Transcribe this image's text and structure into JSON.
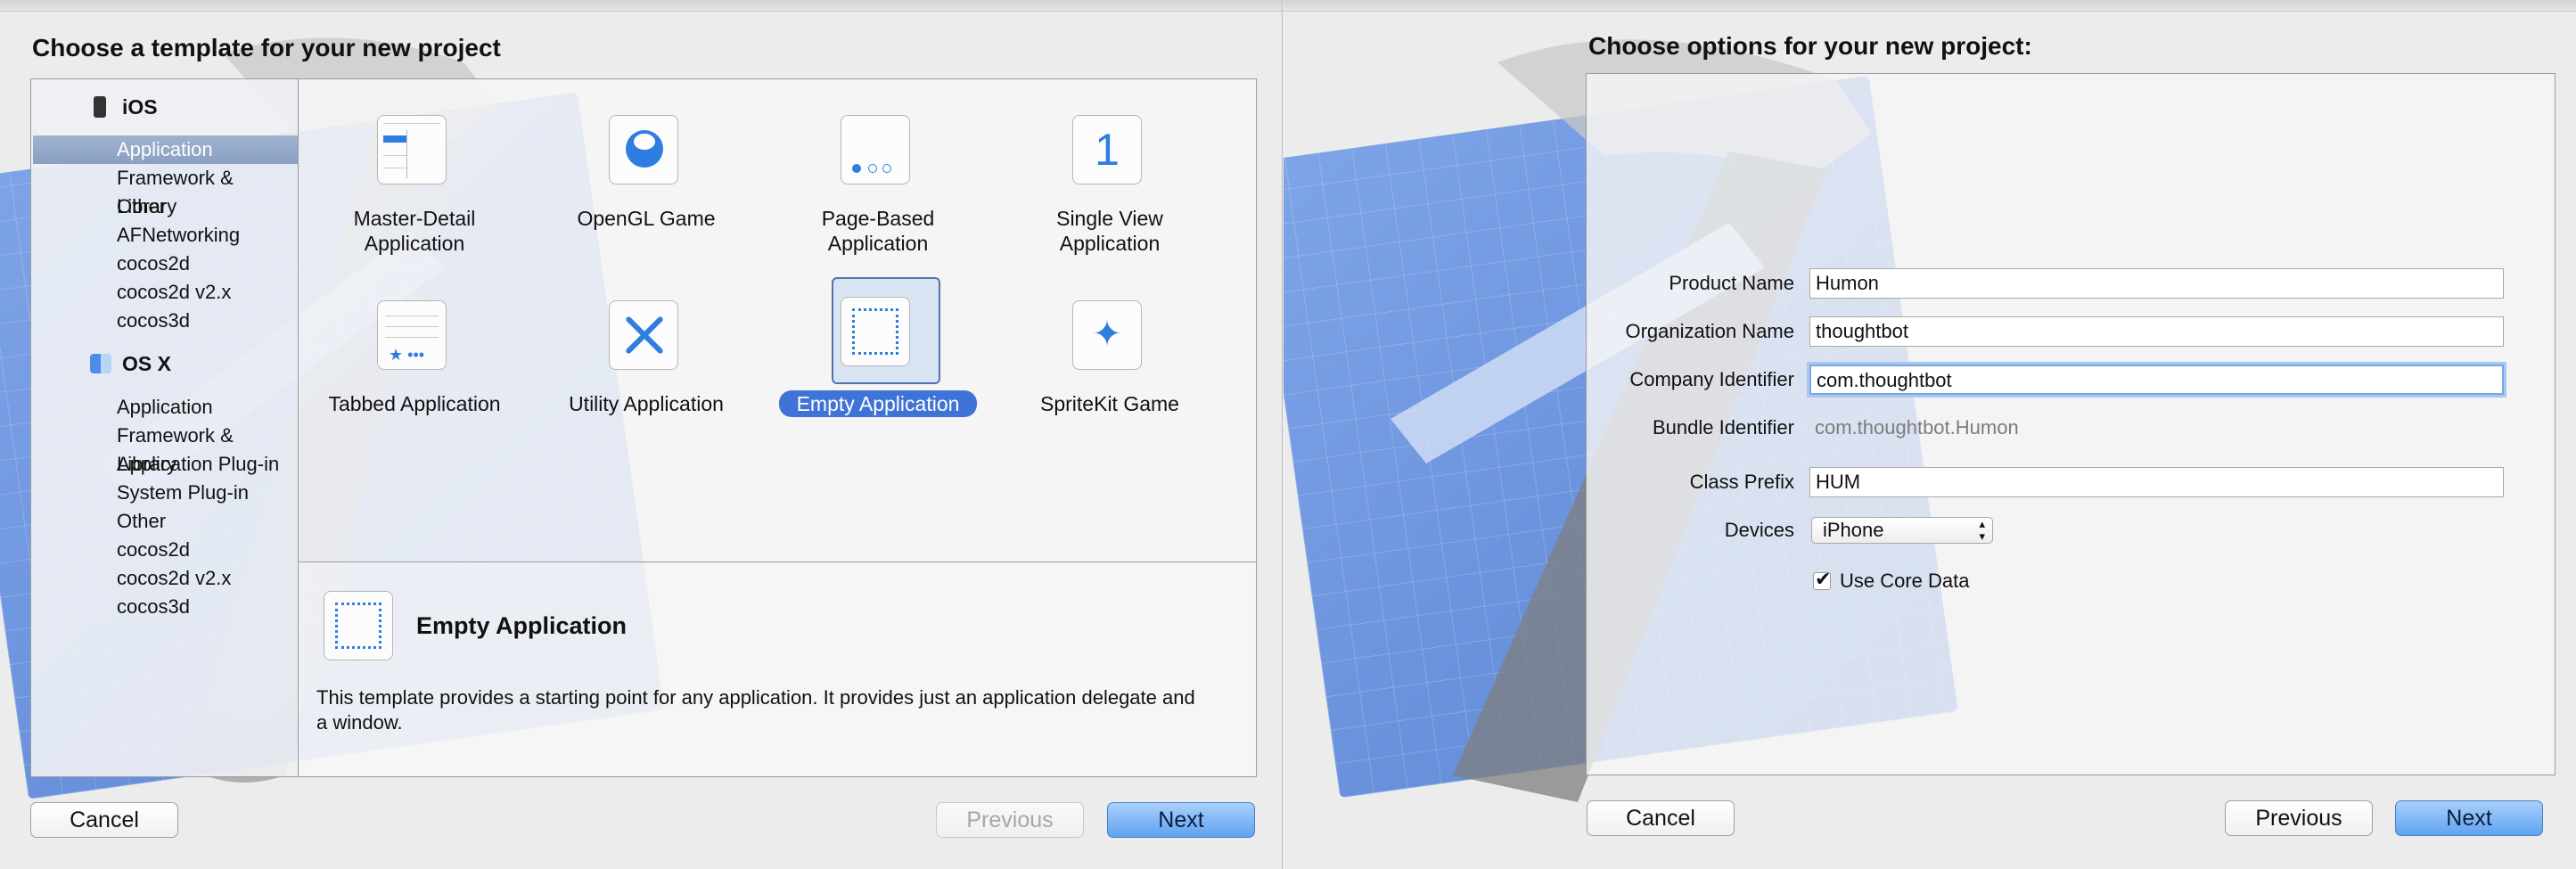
{
  "left": {
    "title": "Choose a template for your new project",
    "sidebar": {
      "ios_header": "iOS",
      "ios_items": [
        "Application",
        "Framework & Library",
        "Other",
        "AFNetworking",
        "cocos2d",
        "cocos2d v2.x",
        "cocos3d"
      ],
      "osx_header": "OS X",
      "osx_items": [
        "Application",
        "Framework & Library",
        "Application Plug-in",
        "System Plug-in",
        "Other",
        "cocos2d",
        "cocos2d v2.x",
        "cocos3d"
      ],
      "selected": "Application"
    },
    "templates": [
      {
        "label": "Master-Detail\nApplication",
        "icon": "master-detail-icon"
      },
      {
        "label": "OpenGL Game",
        "icon": "opengl-icon"
      },
      {
        "label": "Page-Based\nApplication",
        "icon": "page-based-icon"
      },
      {
        "label": "Single View\nApplication",
        "icon": "single-view-icon",
        "glyph": "1"
      },
      {
        "label": "Tabbed Application",
        "icon": "tabbed-icon"
      },
      {
        "label": "Utility Application",
        "icon": "utility-icon"
      },
      {
        "label": "Empty Application",
        "icon": "empty-app-icon",
        "selected": true
      },
      {
        "label": "SpriteKit Game",
        "icon": "spritekit-icon"
      }
    ],
    "description": {
      "title": "Empty Application",
      "text": "This template provides a starting point for any application. It provides just an application delegate and a window."
    },
    "buttons": {
      "cancel": "Cancel",
      "previous": "Previous",
      "next": "Next"
    }
  },
  "right": {
    "title": "Choose options for your new project:",
    "form": {
      "product_name_label": "Product Name",
      "product_name": "Humon",
      "organization_name_label": "Organization Name",
      "organization_name": "thoughtbot",
      "company_identifier_label": "Company Identifier",
      "company_identifier": "com.thoughtbot",
      "bundle_identifier_label": "Bundle Identifier",
      "bundle_identifier": "com.thoughtbot.Humon",
      "class_prefix_label": "Class Prefix",
      "class_prefix": "HUM",
      "devices_label": "Devices",
      "devices_value": "iPhone",
      "use_core_data_label": "Use Core Data",
      "use_core_data": true
    },
    "buttons": {
      "cancel": "Cancel",
      "previous": "Previous",
      "next": "Next"
    }
  },
  "colors": {
    "accent": "#3f74d6",
    "sidebar_selected": "#8fa4c5",
    "blueprint": "#6b93dd",
    "button_primary": "#5fa2f1"
  }
}
